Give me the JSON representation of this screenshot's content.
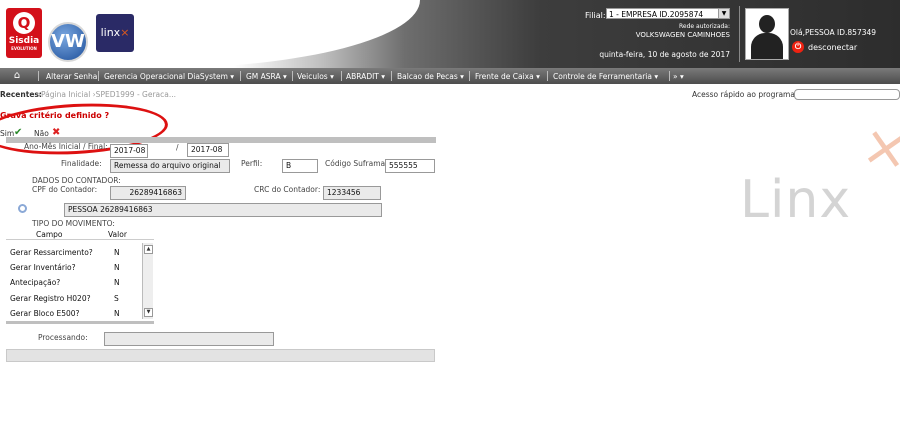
{
  "header": {
    "logos": {
      "sisdia": "Sisdia",
      "sisdia_sub": "EVOLUTION",
      "vw": "VW",
      "linx": "linx"
    },
    "filial_label": "Filial:",
    "filial_value": "1 - EMPRESA ID.2095874",
    "rede_label": "Rede autorizada:",
    "rede_value": "VOLKSWAGEN CAMINHOES",
    "date": "quinta-feira, 10 de agosto de 2017",
    "user_greeting": "Olá,PESSOA ID.857349",
    "logout": "desconectar"
  },
  "nav": {
    "items": [
      "Alterar Senha",
      "Gerencia Operacional DiaSystem ▾",
      "GM ASRA ▾",
      "Veiculos ▾",
      "ABRADIT ▾",
      "Balcao de Pecas ▾",
      "Frente de Caixa ▾",
      "Controle de Ferramentaria ▾",
      "» ▾"
    ]
  },
  "recent": {
    "label": "Recentes:",
    "items": "›Página Inicial ›SPED1999 - Geraca...",
    "quick_label": "Acesso rápido ao programa:",
    "quick_value": ""
  },
  "dialog": {
    "title": "Grava critério definido ?",
    "sim": "Sim",
    "nao": "Não"
  },
  "form": {
    "ano_mes_label": "Ano-Mês Inicial / Final:",
    "ano_mes_inicial": "2017-08",
    "ano_mes_sep": "/",
    "ano_mes_final": "2017-08",
    "finalidade_label": "Finalidade:",
    "finalidade": "Remessa do arquivo original",
    "perfil_label": "Perfil:",
    "perfil": "B",
    "suframa_label": "Código Suframa:",
    "suframa": "555555",
    "contador_section": "DADOS DO CONTADOR:",
    "cpf_label": "CPF do Contador:",
    "cpf": "26289416863",
    "crc_label": "CRC do Contador:",
    "crc": "1233456",
    "contador_nome": "PESSOA 26289416863",
    "movimento_section": "TIPO DO MOVIMENTO:",
    "grid": {
      "headers": [
        "Campo",
        "Valor"
      ],
      "rows": [
        {
          "campo": "Gerar Ressarcimento?",
          "valor": "N"
        },
        {
          "campo": "Gerar Inventário?",
          "valor": "N"
        },
        {
          "campo": "Antecipação?",
          "valor": "N"
        },
        {
          "campo": "Gerar Registro H020?",
          "valor": "S"
        },
        {
          "campo": "Gerar Bloco E500?",
          "valor": "N"
        }
      ]
    },
    "processando_label": "Processando:",
    "processando": ""
  },
  "watermark": "Linx",
  "colors": {
    "accent": "#d3101a",
    "nav": "#5a5a5a",
    "title": "#cc0000"
  }
}
